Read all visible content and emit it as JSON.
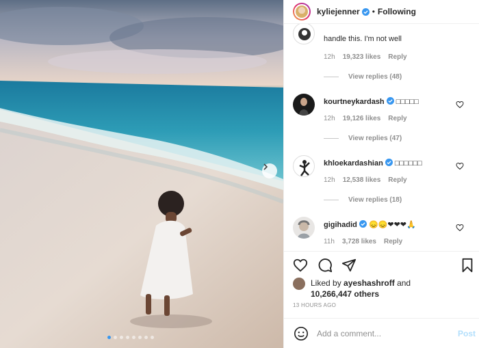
{
  "header": {
    "username": "kyliejenner",
    "separator": "•",
    "follow_status": "Following"
  },
  "photo": {
    "carousel_dots": 8,
    "active_dot": 0
  },
  "comments": [
    {
      "username": "",
      "text": "handle this. I'm not well",
      "time": "12h",
      "likes": "19,323 likes",
      "reply": "Reply",
      "view_replies": "View replies (48)"
    },
    {
      "username": "kourtneykardash",
      "verified": true,
      "text": "□□□□□",
      "time": "12h",
      "likes": "19,126 likes",
      "reply": "Reply",
      "view_replies": "View replies (47)"
    },
    {
      "username": "khloekardashian",
      "verified": true,
      "text": "□□□□□□",
      "time": "12h",
      "likes": "12,538 likes",
      "reply": "Reply",
      "view_replies": "View replies (18)"
    },
    {
      "username": "gigihadid",
      "verified": true,
      "text": "😞😞❤❤❤🙏",
      "time": "11h",
      "likes": "3,728 likes",
      "reply": "Reply"
    }
  ],
  "likes": {
    "prefix": "Liked by ",
    "user": "ayeshashroff",
    "middle": " and",
    "count": "10,266,447 others"
  },
  "timestamp": "13 HOURS AGO",
  "add_comment": {
    "placeholder": "Add a comment...",
    "post_label": "Post"
  },
  "colors": {
    "verified_blue": "#3897f0",
    "post_disabled": "#b2dffc",
    "muted_text": "#8e8e8e"
  }
}
